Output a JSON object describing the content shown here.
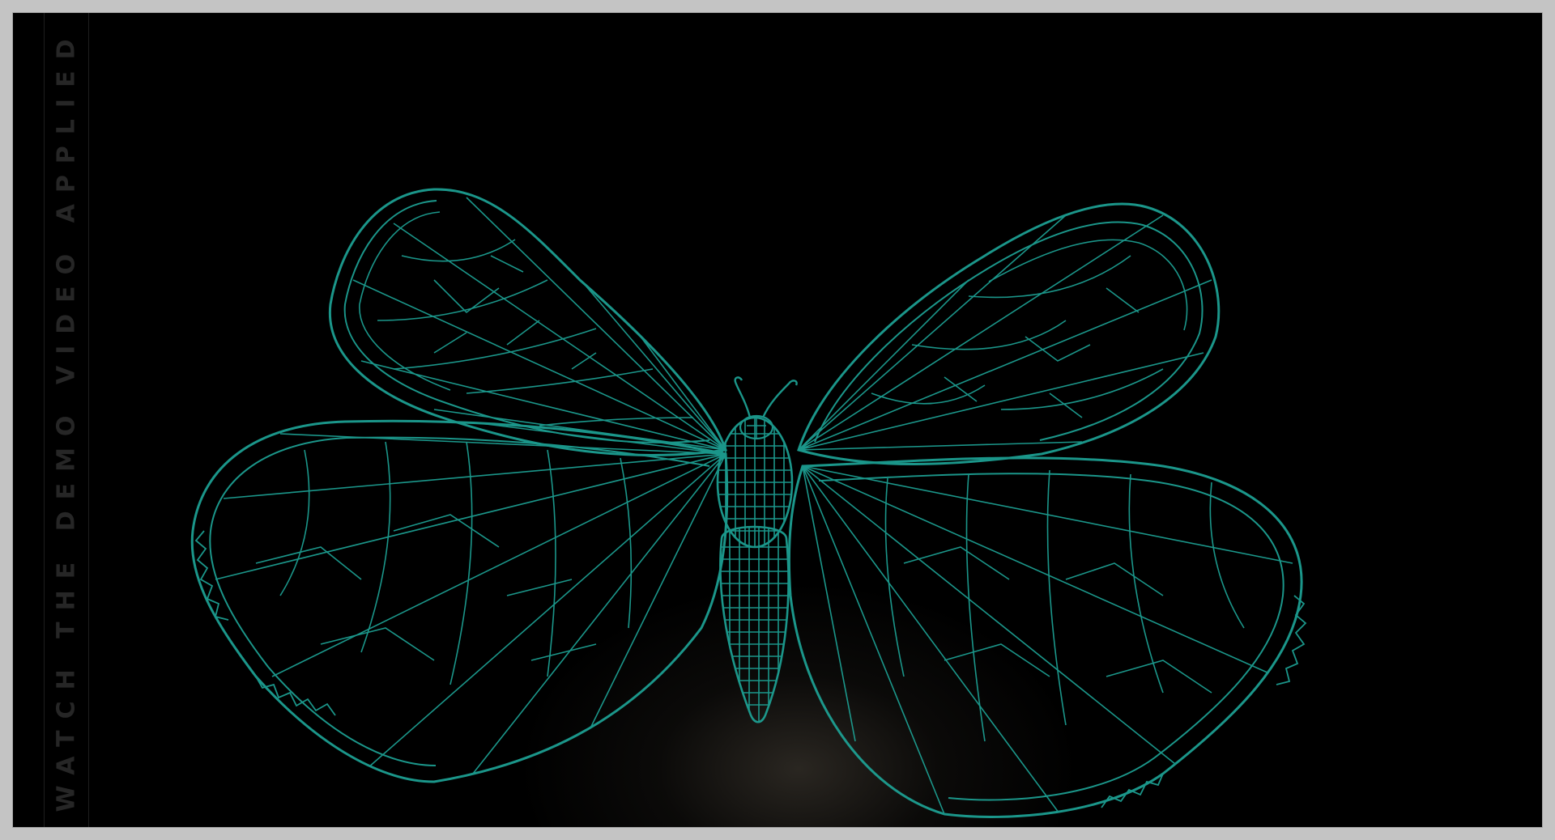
{
  "side_link": {
    "label": "WATCH THE DEMO VIDEO APPLIED"
  },
  "viewport": {
    "subject": "butterfly-wireframe-icon"
  },
  "colors": {
    "background": "#000000",
    "frame": "#c4c4c4",
    "wireframe": "#1fa89a",
    "side_text": "#262626"
  }
}
